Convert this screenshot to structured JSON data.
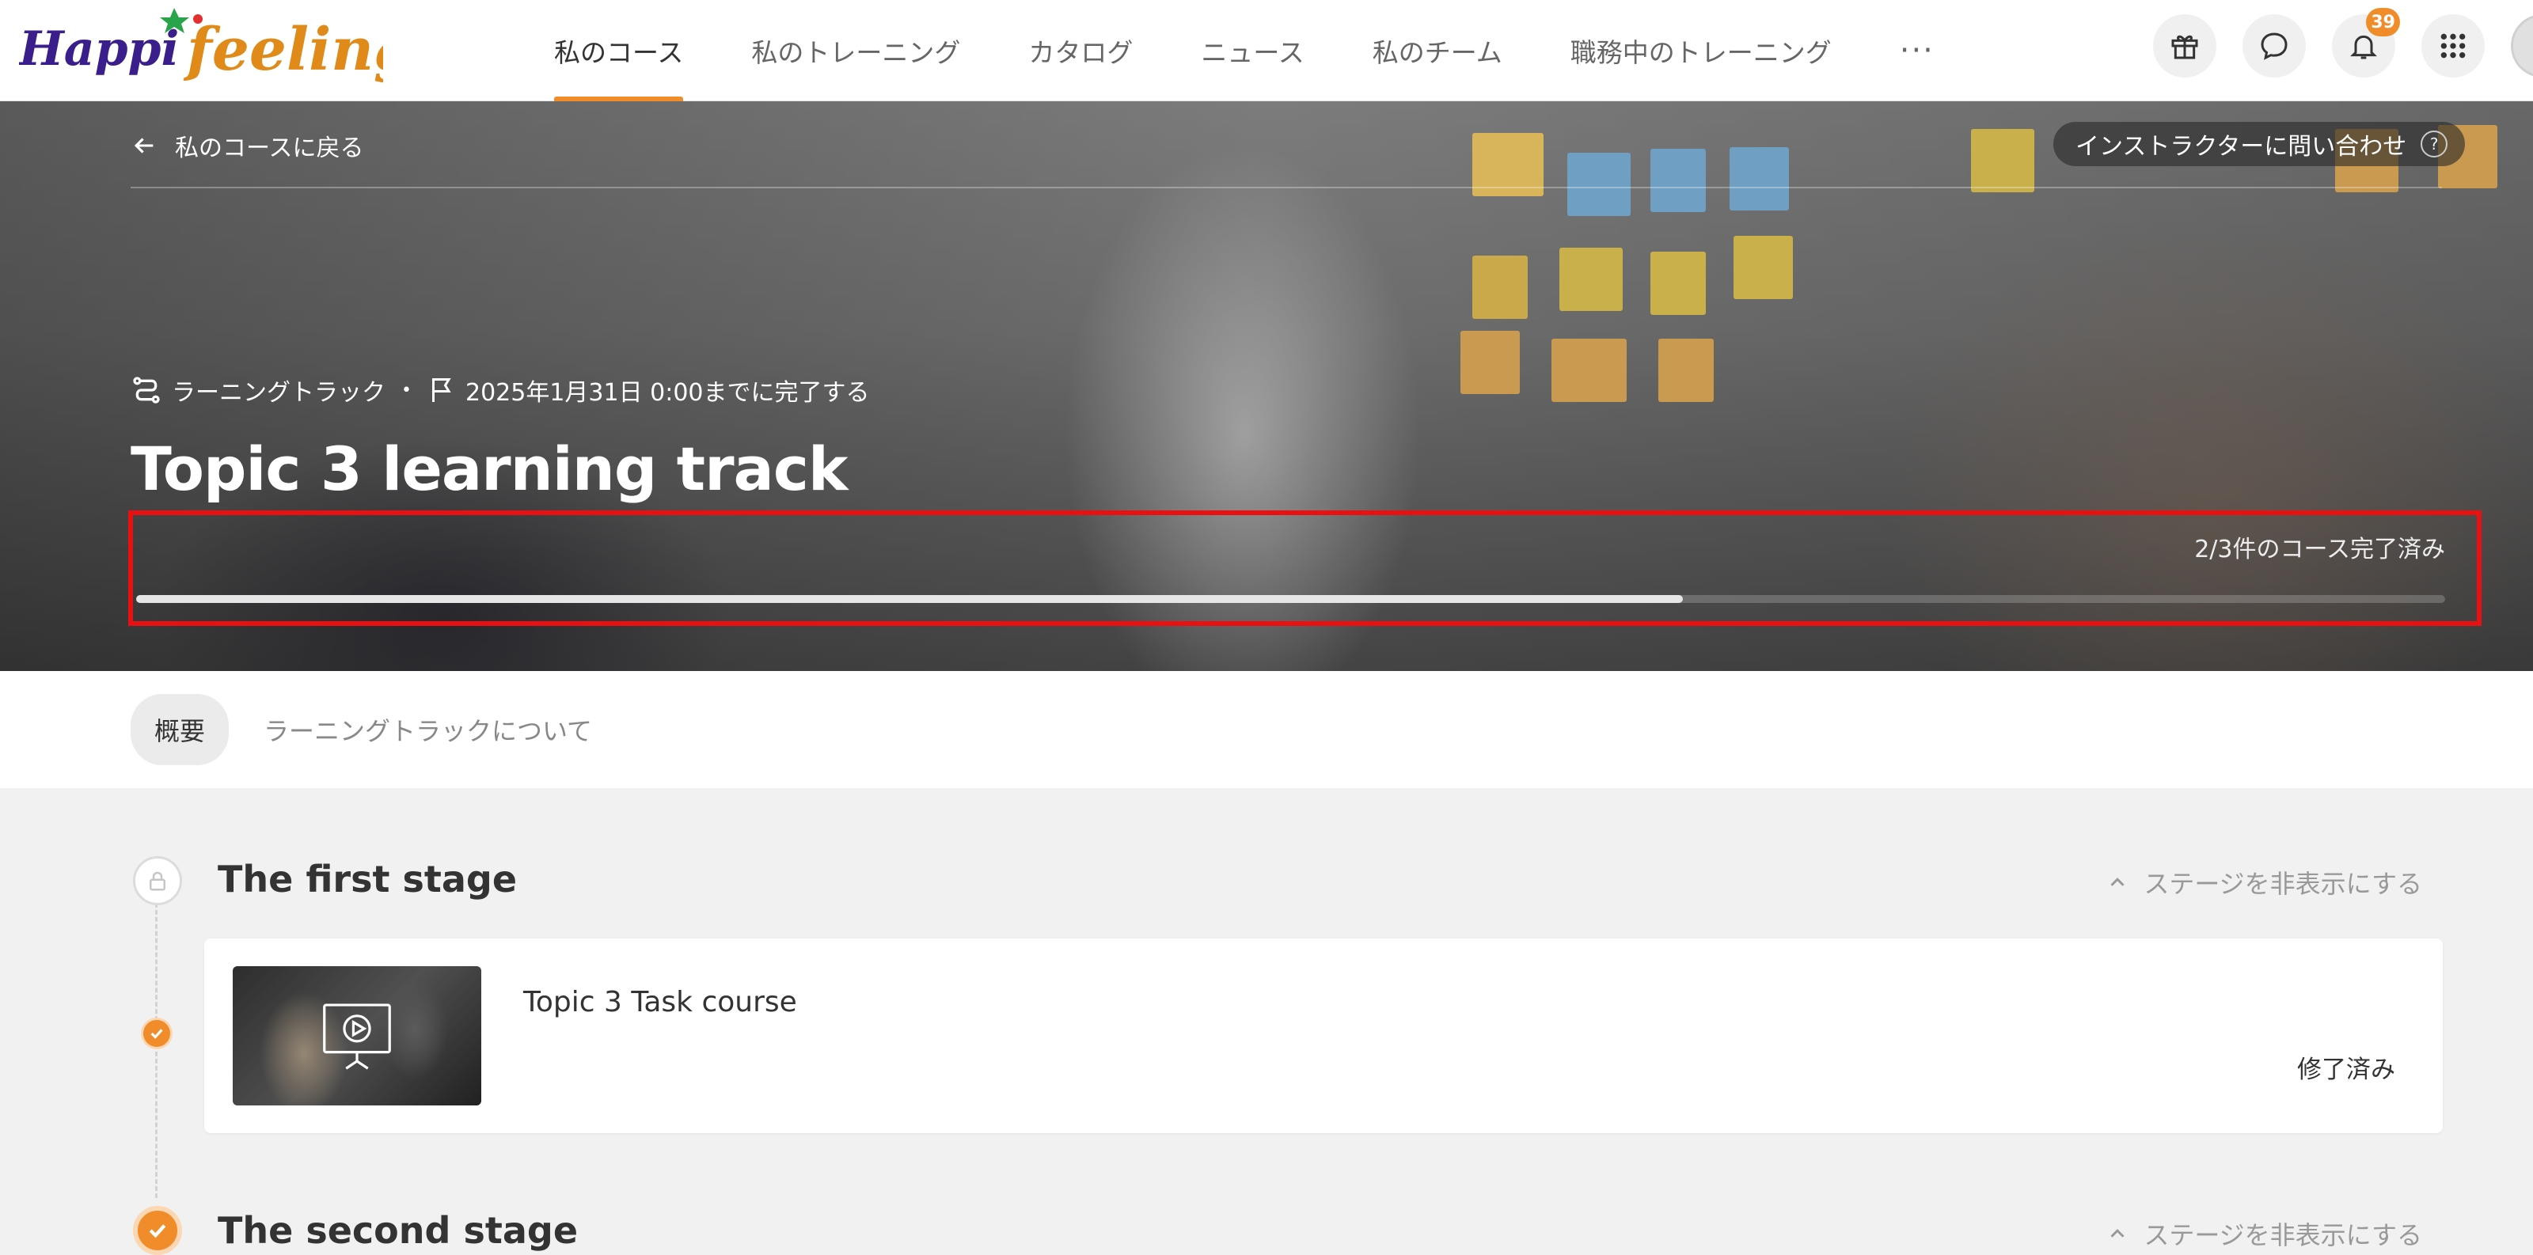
{
  "brand": {
    "logo_text_1": "Happi",
    "logo_text_2": "feeling",
    "accent": "#f08c2a"
  },
  "nav": {
    "items": [
      {
        "label": "私のコース",
        "active": true
      },
      {
        "label": "私のトレーニング"
      },
      {
        "label": "カタログ"
      },
      {
        "label": "ニュース"
      },
      {
        "label": "私のチーム"
      },
      {
        "label": "職務中のトレーニング"
      }
    ],
    "more_label": "···",
    "notification_count": "39",
    "icons": [
      "gift-icon",
      "chat-icon",
      "bell-icon",
      "apps-grid-icon",
      "avatar"
    ]
  },
  "hero": {
    "back_label": "私のコースに戻る",
    "ask_instructor_label": "インストラクターに問い合わせ",
    "ask_help_glyph": "?",
    "type_label": "ラーニングトラック",
    "separator": "•",
    "due_label": "2025年1月31日 0:00までに完了する",
    "title": "Topic 3 learning track",
    "progress_text": "2/3件のコース完了済み",
    "progress_fraction": 0.67
  },
  "tabs": [
    {
      "label": "概要",
      "active": true
    },
    {
      "label": "ラーニングトラックについて"
    }
  ],
  "stages": [
    {
      "title": "The first stage",
      "toggle_label": "ステージを非表示にする",
      "state": "locked",
      "courses": [
        {
          "title": "Topic 3 Task course",
          "status": "修了済み",
          "completed": true
        }
      ]
    },
    {
      "title": "The second stage",
      "toggle_label": "ステージを非表示にする",
      "state": "done"
    }
  ]
}
